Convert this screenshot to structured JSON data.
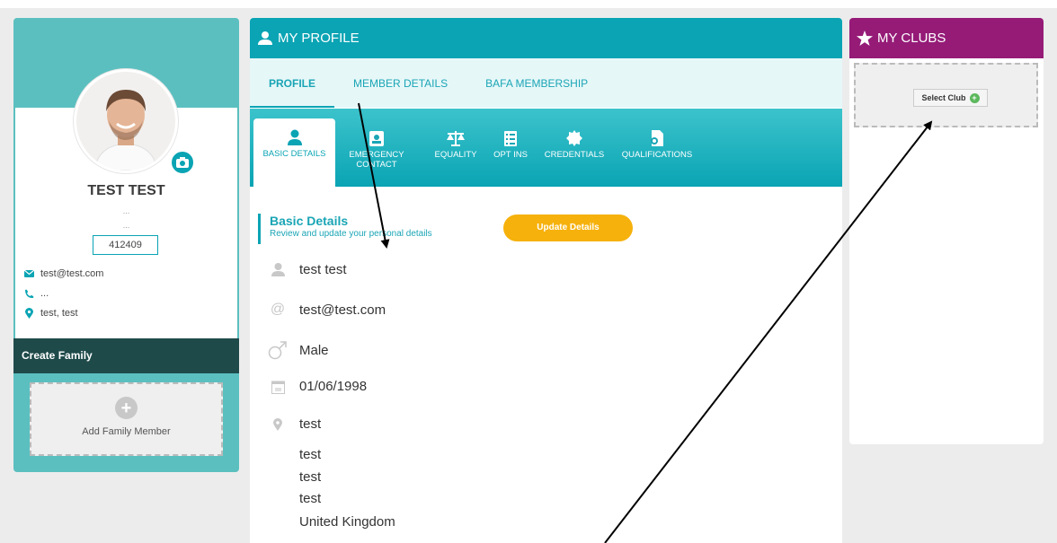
{
  "colors": {
    "teal": "#0aa4b4",
    "teal_light": "#5bbfbf",
    "dark_teal": "#1f4a4a",
    "purple": "#951b77",
    "orange": "#f6b10c"
  },
  "profile_card": {
    "name": "TEST TEST",
    "line1": "...",
    "line2": "...",
    "member_id": "412409",
    "email": "test@test.com",
    "phone": "...",
    "location": "test, test",
    "create_family": "Create Family",
    "add_family_member": "Add Family Member"
  },
  "main": {
    "header": "MY PROFILE",
    "tabs": [
      {
        "label": "PROFILE",
        "active": true
      },
      {
        "label": "MEMBER DETAILS",
        "active": false
      },
      {
        "label": "BAFA MEMBERSHIP",
        "active": false
      }
    ],
    "sub_tabs": [
      {
        "label": "BASIC DETAILS",
        "icon": "person-icon",
        "active": true
      },
      {
        "label": "EMERGENCY CONTACT",
        "icon": "contact-card-icon",
        "active": false
      },
      {
        "label": "EQUALITY",
        "icon": "scales-icon",
        "active": false
      },
      {
        "label": "OPT INS",
        "icon": "checklist-icon",
        "active": false
      },
      {
        "label": "CREDENTIALS",
        "icon": "badge-icon",
        "active": false
      },
      {
        "label": "QUALIFICATIONS",
        "icon": "certificate-icon",
        "active": false
      }
    ],
    "section_title": "Basic Details",
    "section_subtitle": "Review and update your personal details",
    "update_button": "Update Details",
    "details": {
      "name": "test test",
      "email": "test@test.com",
      "gender": "Male",
      "dob": "01/06/1998",
      "address": [
        "test",
        "test",
        "test",
        "test",
        "United Kingdom"
      ]
    }
  },
  "clubs": {
    "header": "MY CLUBS",
    "select_club": "Select Club"
  }
}
